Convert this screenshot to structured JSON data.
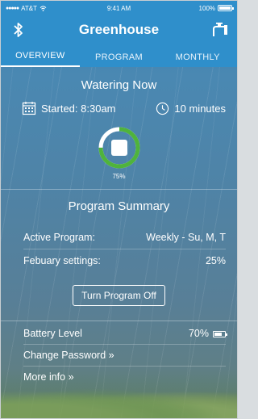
{
  "status_bar": {
    "carrier": "AT&T",
    "time": "9:41 AM",
    "battery": "100%"
  },
  "header": {
    "title": "Greenhouse",
    "left_icon": "bluetooth-icon",
    "right_icon": "faucet-icon"
  },
  "tabs": [
    {
      "label": "OVERVIEW",
      "active": true
    },
    {
      "label": "PROGRAM",
      "active": false
    },
    {
      "label": "MONTHLY",
      "active": false
    }
  ],
  "watering": {
    "title": "Watering Now",
    "started": "Started: 8:30am",
    "duration": "10 minutes",
    "progress_percent": 75,
    "progress_label": "75%"
  },
  "summary": {
    "title": "Program Summary",
    "rows": [
      {
        "label": "Active Program:",
        "value": "Weekly - Su, M, T"
      },
      {
        "label": "Febuary settings:",
        "value": "25%"
      }
    ],
    "button_label": "Turn Program Off"
  },
  "footer": {
    "battery_label": "Battery  Level",
    "battery_value": "70%",
    "change_password": "Change Password »",
    "more_info": "More info »"
  },
  "colors": {
    "header_blue": "#2f8fcb",
    "progress_green": "#4fb33c",
    "progress_track": "#ffffff"
  }
}
